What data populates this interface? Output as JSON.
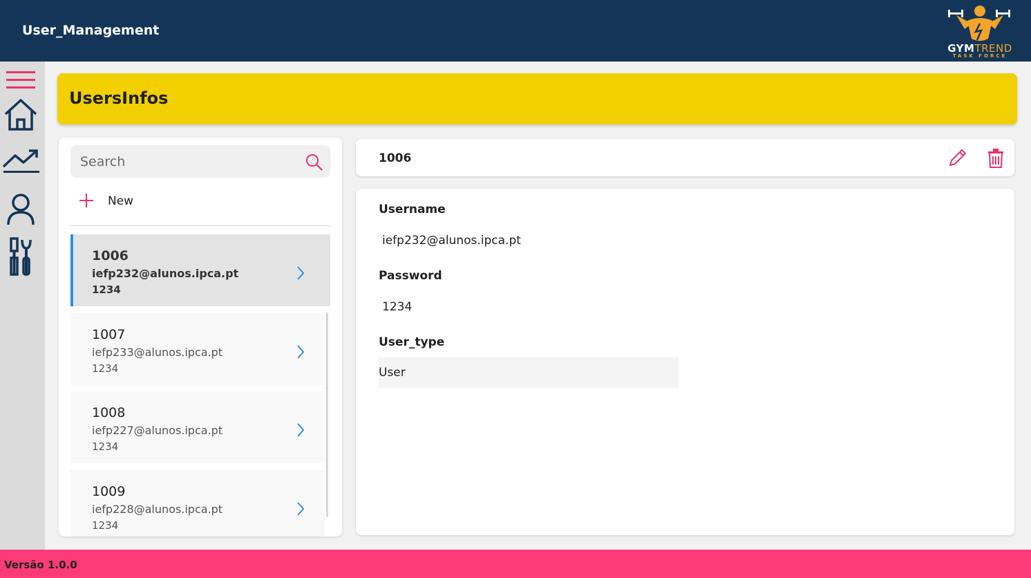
{
  "app": {
    "title": "User_Management"
  },
  "logo": {
    "word_main": "GYM",
    "word_accent": "TREND",
    "subtitle": "TASK FORCE"
  },
  "sidebar": {
    "items": [
      {
        "name": "menu",
        "icon": "hamburger-menu-icon"
      },
      {
        "name": "home",
        "icon": "home-icon"
      },
      {
        "name": "stats",
        "icon": "trend-chart-icon"
      },
      {
        "name": "users",
        "icon": "user-icon"
      },
      {
        "name": "settings",
        "icon": "tools-icon"
      }
    ]
  },
  "header": {
    "title": "UsersInfos"
  },
  "list": {
    "search_placeholder": "Search",
    "new_label": "New",
    "items": [
      {
        "id": "1006",
        "email": "iefp232@alunos.ipca.pt",
        "password": "1234",
        "selected": true
      },
      {
        "id": "1007",
        "email": "iefp233@alunos.ipca.pt",
        "password": "1234",
        "selected": false
      },
      {
        "id": "1008",
        "email": "iefp227@alunos.ipca.pt",
        "password": "1234",
        "selected": false
      },
      {
        "id": "1009",
        "email": "iefp228@alunos.ipca.pt",
        "password": "1234",
        "selected": false
      }
    ]
  },
  "detail": {
    "id": "1006",
    "username_label": "Username",
    "username_value": "iefp232@alunos.ipca.pt",
    "password_label": "Password",
    "password_value": "1234",
    "user_type_label": "User_type",
    "user_type_value": "User"
  },
  "footer": {
    "version": "Versão 1.0.0"
  },
  "colors": {
    "topbar": "#143557",
    "accent_pink": "#fd3b78",
    "header_yellow": "#f2d000",
    "selection_blue": "#2b8fe3",
    "icon_pink": "#e8336b"
  }
}
